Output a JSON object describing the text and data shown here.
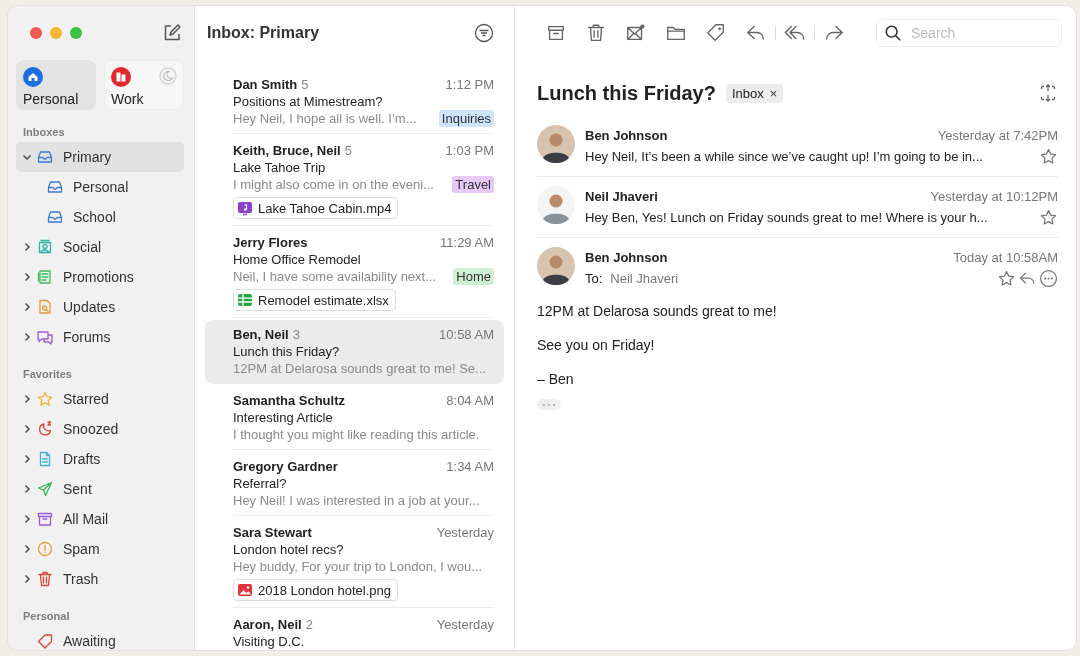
{
  "accounts": [
    {
      "name": "Personal",
      "selected": true
    },
    {
      "name": "Work",
      "selected": false
    }
  ],
  "sidebar": [
    {
      "title": "Inboxes",
      "items": [
        {
          "label": "Primary",
          "expanded": true,
          "selected": true,
          "children": [
            {
              "label": "Personal",
              "selected": false
            },
            {
              "label": "School",
              "selected": false
            }
          ]
        },
        {
          "label": "Social",
          "expanded": false,
          "selected": false
        },
        {
          "label": "Promotions",
          "expanded": false,
          "selected": false
        },
        {
          "label": "Updates",
          "expanded": false,
          "selected": false
        },
        {
          "label": "Forums",
          "expanded": false,
          "selected": false
        }
      ]
    },
    {
      "title": "Favorites",
      "items": [
        {
          "label": "Starred",
          "expanded": false,
          "selected": false
        },
        {
          "label": "Snoozed",
          "expanded": false,
          "selected": false
        },
        {
          "label": "Drafts",
          "expanded": false,
          "selected": false
        },
        {
          "label": "Sent",
          "expanded": false,
          "selected": false
        },
        {
          "label": "All Mail",
          "expanded": false,
          "selected": false
        },
        {
          "label": "Spam",
          "expanded": false,
          "selected": false
        },
        {
          "label": "Trash",
          "expanded": false,
          "selected": false
        }
      ]
    },
    {
      "title": "Personal",
      "items": [
        {
          "label": "Awaiting",
          "selected": false
        }
      ]
    }
  ],
  "list": {
    "title": "Inbox: Primary",
    "messages": [
      {
        "sender": "Dan Smith",
        "count": "5",
        "time": "1:12 PM",
        "subject": "Positions at Mimestream?",
        "preview": "Hey Neil, I hope all is well. I’m...",
        "tag": {
          "label": "Inquiries",
          "color": "#cfe4fb"
        },
        "selected": false
      },
      {
        "sender": "Keith, Bruce, Neil",
        "count": "5",
        "time": "1:03 PM",
        "subject": "Lake Tahoe Trip",
        "preview": "I might also come in on the eveni...",
        "tag": {
          "label": "Travel",
          "color": "#e6c9f7"
        },
        "attachment": {
          "name": "Lake Tahoe Cabin.mp4",
          "kind": "video"
        },
        "selected": false
      },
      {
        "sender": "Jerry Flores",
        "time": "11:29 AM",
        "subject": "Home Office Remodel",
        "preview": "Neil, I have some availability next...",
        "tag": {
          "label": "Home",
          "color": "#cdf1d2"
        },
        "attachment": {
          "name": "Remodel estimate.xlsx",
          "kind": "sheet"
        },
        "selected": false
      },
      {
        "sender": "Ben, Neil",
        "count": "3",
        "time": "10:58 AM",
        "subject": "Lunch this Friday?",
        "preview": "12PM at Delarosa sounds great to me! Se...",
        "selected": true
      },
      {
        "sender": "Samantha Schultz",
        "time": "8:04 AM",
        "subject": "Interesting Article",
        "preview": "I thought you might like reading this article.",
        "selected": false
      },
      {
        "sender": "Gregory Gardner",
        "time": "1:34 AM",
        "subject": "Referral?",
        "preview": "Hey Neil! I was interested in a job at your...",
        "selected": false
      },
      {
        "sender": "Sara Stewart",
        "time": "Yesterday",
        "subject": "London hotel recs?",
        "preview": "Hey buddy, For your trip to London, I wou...",
        "attachment": {
          "name": "2018 London hotel.png",
          "kind": "image"
        },
        "selected": false
      },
      {
        "sender": "Aaron, Neil",
        "count": "2",
        "time": "Yesterday",
        "subject": "Visiting D.C.",
        "selected": false
      }
    ]
  },
  "reader": {
    "search": {
      "placeholder": "Search"
    },
    "subject": "Lunch this Friday?",
    "label": {
      "text": "Inbox",
      "remove": "×"
    },
    "thread": [
      {
        "sender": "Ben Johnson",
        "time": "Yesterday at 7:42PM",
        "snippet": "Hey Neil, It’s been a while since we’ve caught up! I’m going to be in...",
        "starred": false,
        "expanded": false
      },
      {
        "sender": "Neil Jhaveri",
        "time": "Yesterday at 10:12PM",
        "snippet": "Hey Ben, Yes! Lunch on Friday sounds great to me! Where is your h...",
        "starred": false,
        "expanded": false
      },
      {
        "sender": "Ben Johnson",
        "time": "Today at 10:58AM",
        "to_label": "To:",
        "to": "Neil Jhaveri",
        "starred": false,
        "expanded": true,
        "body": [
          "12PM at Delarosa sounds great to me!",
          "See you on Friday!",
          "– Ben"
        ]
      }
    ]
  }
}
